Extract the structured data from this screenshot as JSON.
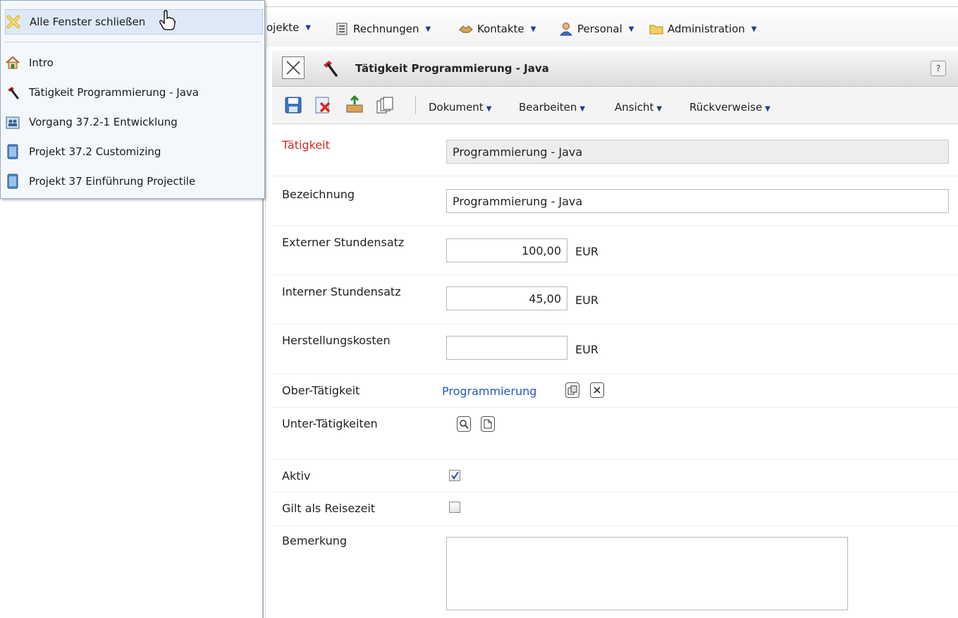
{
  "window_menu": {
    "close_all": "Alle Fenster schließen",
    "items": [
      {
        "label": "Intro",
        "icon": "home-icon"
      },
      {
        "label": "Tätigkeit Programmierung - Java",
        "icon": "hammer-icon"
      },
      {
        "label": "Vorgang 37.2-1 Entwicklung",
        "icon": "people-icon"
      },
      {
        "label": "Projekt 37.2 Customizing",
        "icon": "book-icon"
      },
      {
        "label": "Projekt 37 Einführung Projectile",
        "icon": "book-icon"
      }
    ]
  },
  "menubar": {
    "items": [
      "ojekte",
      "Rechnungen",
      "Kontakte",
      "Personal",
      "Administration"
    ]
  },
  "form": {
    "title": "Tätigkeit Programmierung - Java",
    "help": "?",
    "toolbar_menus": [
      "Dokument",
      "Bearbeiten",
      "Ansicht",
      "Rückverweise"
    ],
    "fields": {
      "taetigkeit": {
        "label": "Tätigkeit",
        "value": "Programmierung  - Java"
      },
      "bezeichnung": {
        "label": "Bezeichnung",
        "value": "Programmierung  - Java"
      },
      "ext_satz": {
        "label": "Externer Stundensatz",
        "value": "100,00",
        "unit": "EUR"
      },
      "int_satz": {
        "label": "Interner Stundensatz",
        "value": "45,00",
        "unit": "EUR"
      },
      "herstellung": {
        "label": "Herstellungskosten",
        "value": "",
        "unit": "EUR"
      },
      "ober": {
        "label": "Ober-Tätigkeit",
        "link": "Programmierung"
      },
      "unter": {
        "label": "Unter-Tätigkeiten"
      },
      "aktiv": {
        "label": "Aktiv",
        "checked": true
      },
      "reise": {
        "label": "Gilt als Reisezeit",
        "checked": false
      },
      "bemerkung": {
        "label": "Bemerkung",
        "value": ""
      }
    }
  },
  "colors": {
    "accent_link": "#2657c5",
    "required_label": "#d12a2a"
  }
}
